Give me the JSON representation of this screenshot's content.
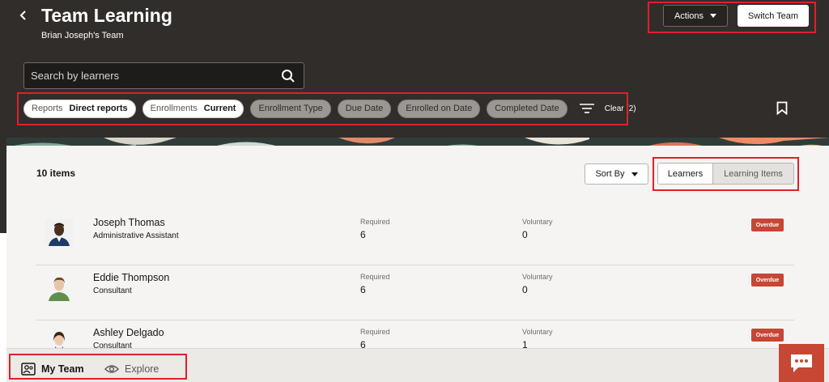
{
  "header": {
    "back_icon": "chevron-left-icon",
    "title": "Team Learning",
    "subtitle": "Brian Joseph's Team",
    "actions_label": "Actions",
    "switch_team_label": "Switch Team"
  },
  "search": {
    "placeholder": "Search by learners",
    "value": ""
  },
  "filters": {
    "chips": [
      {
        "key": "Reports",
        "value": "Direct reports"
      },
      {
        "key": "Enrollments",
        "value": "Current"
      }
    ],
    "idle_chips": [
      "Enrollment Type",
      "Due Date",
      "Enrolled on Date",
      "Completed Date"
    ],
    "clear_label": "Clear (2)"
  },
  "toolbar": {
    "items_count": "10 items",
    "sort_by_label": "Sort By",
    "view_toggle": [
      "Learners",
      "Learning Items"
    ],
    "selected_view": "Learners"
  },
  "learners": [
    {
      "name": "Joseph Thomas",
      "role": "Administrative Assistant",
      "required_label": "Required",
      "required": "6",
      "voluntary_label": "Voluntary",
      "voluntary": "0",
      "status": "Overdue"
    },
    {
      "name": "Eddie Thompson",
      "role": "Consultant",
      "required_label": "Required",
      "required": "6",
      "voluntary_label": "Voluntary",
      "voluntary": "0",
      "status": "Overdue"
    },
    {
      "name": "Ashley Delgado",
      "role": "Consultant",
      "required_label": "Required",
      "required": "6",
      "voluntary_label": "Voluntary",
      "voluntary": "1",
      "status": "Overdue"
    }
  ],
  "bottom_nav": {
    "my_team": "My Team",
    "explore": "Explore"
  },
  "colors": {
    "header_bg": "#312d2a",
    "overdue": "#c74634",
    "highlight": "#e0202a"
  }
}
